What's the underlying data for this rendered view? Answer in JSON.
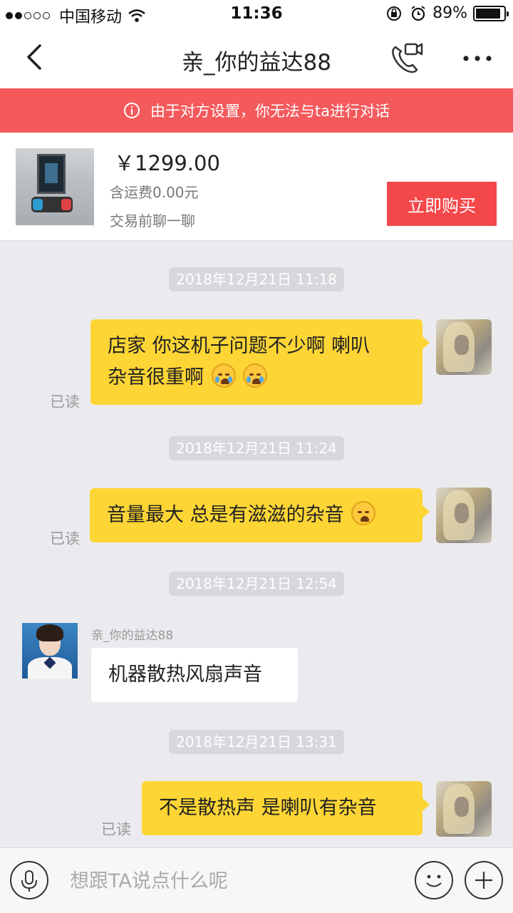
{
  "status_bar": {
    "carrier": "中国移动",
    "time": "11:36",
    "battery": "89%",
    "battery_level": 0.89,
    "signal_bars_filled": 2,
    "signal_bars_total": 5
  },
  "nav": {
    "title": "亲_你的益达88",
    "icons": [
      "back-arrow-icon",
      "video-call-icon",
      "more-icon"
    ]
  },
  "banner": {
    "text": "由于对方设置，你无法与ta进行对话",
    "color": "#f45a5c"
  },
  "product": {
    "price": "￥1299.00",
    "shipping": "含运费0.00元",
    "chat_note": "交易前聊一聊",
    "buy_label": "立即购买",
    "buy_color": "#f4474a"
  },
  "chat": {
    "timestamps": [
      "2018年12月21日  11:18",
      "2018年12月21日  11:24",
      "2018年12月21日  12:54",
      "2018年12月21日  13:31"
    ],
    "read_label": "已读",
    "other_name": "亲_你的益达88",
    "messages": [
      {
        "from": "me",
        "line1": "店家 你这机子问题不少啊 喇叭",
        "line2": "杂音很重啊",
        "emoji": [
          "crying-face-icon",
          "crying-face-icon"
        ]
      },
      {
        "from": "me",
        "text": "音量最大 总是有滋滋的杂音",
        "emoji": [
          "tired-face-icon"
        ]
      },
      {
        "from": "other",
        "text": "机器散热风扇声音"
      },
      {
        "from": "me",
        "text": "不是散热声 是喇叭有杂音"
      }
    ],
    "bubble_color": "#fdd535"
  },
  "input_bar": {
    "placeholder": "想跟TA说点什么呢",
    "icons": [
      "microphone-icon",
      "emoji-icon",
      "plus-icon"
    ]
  }
}
